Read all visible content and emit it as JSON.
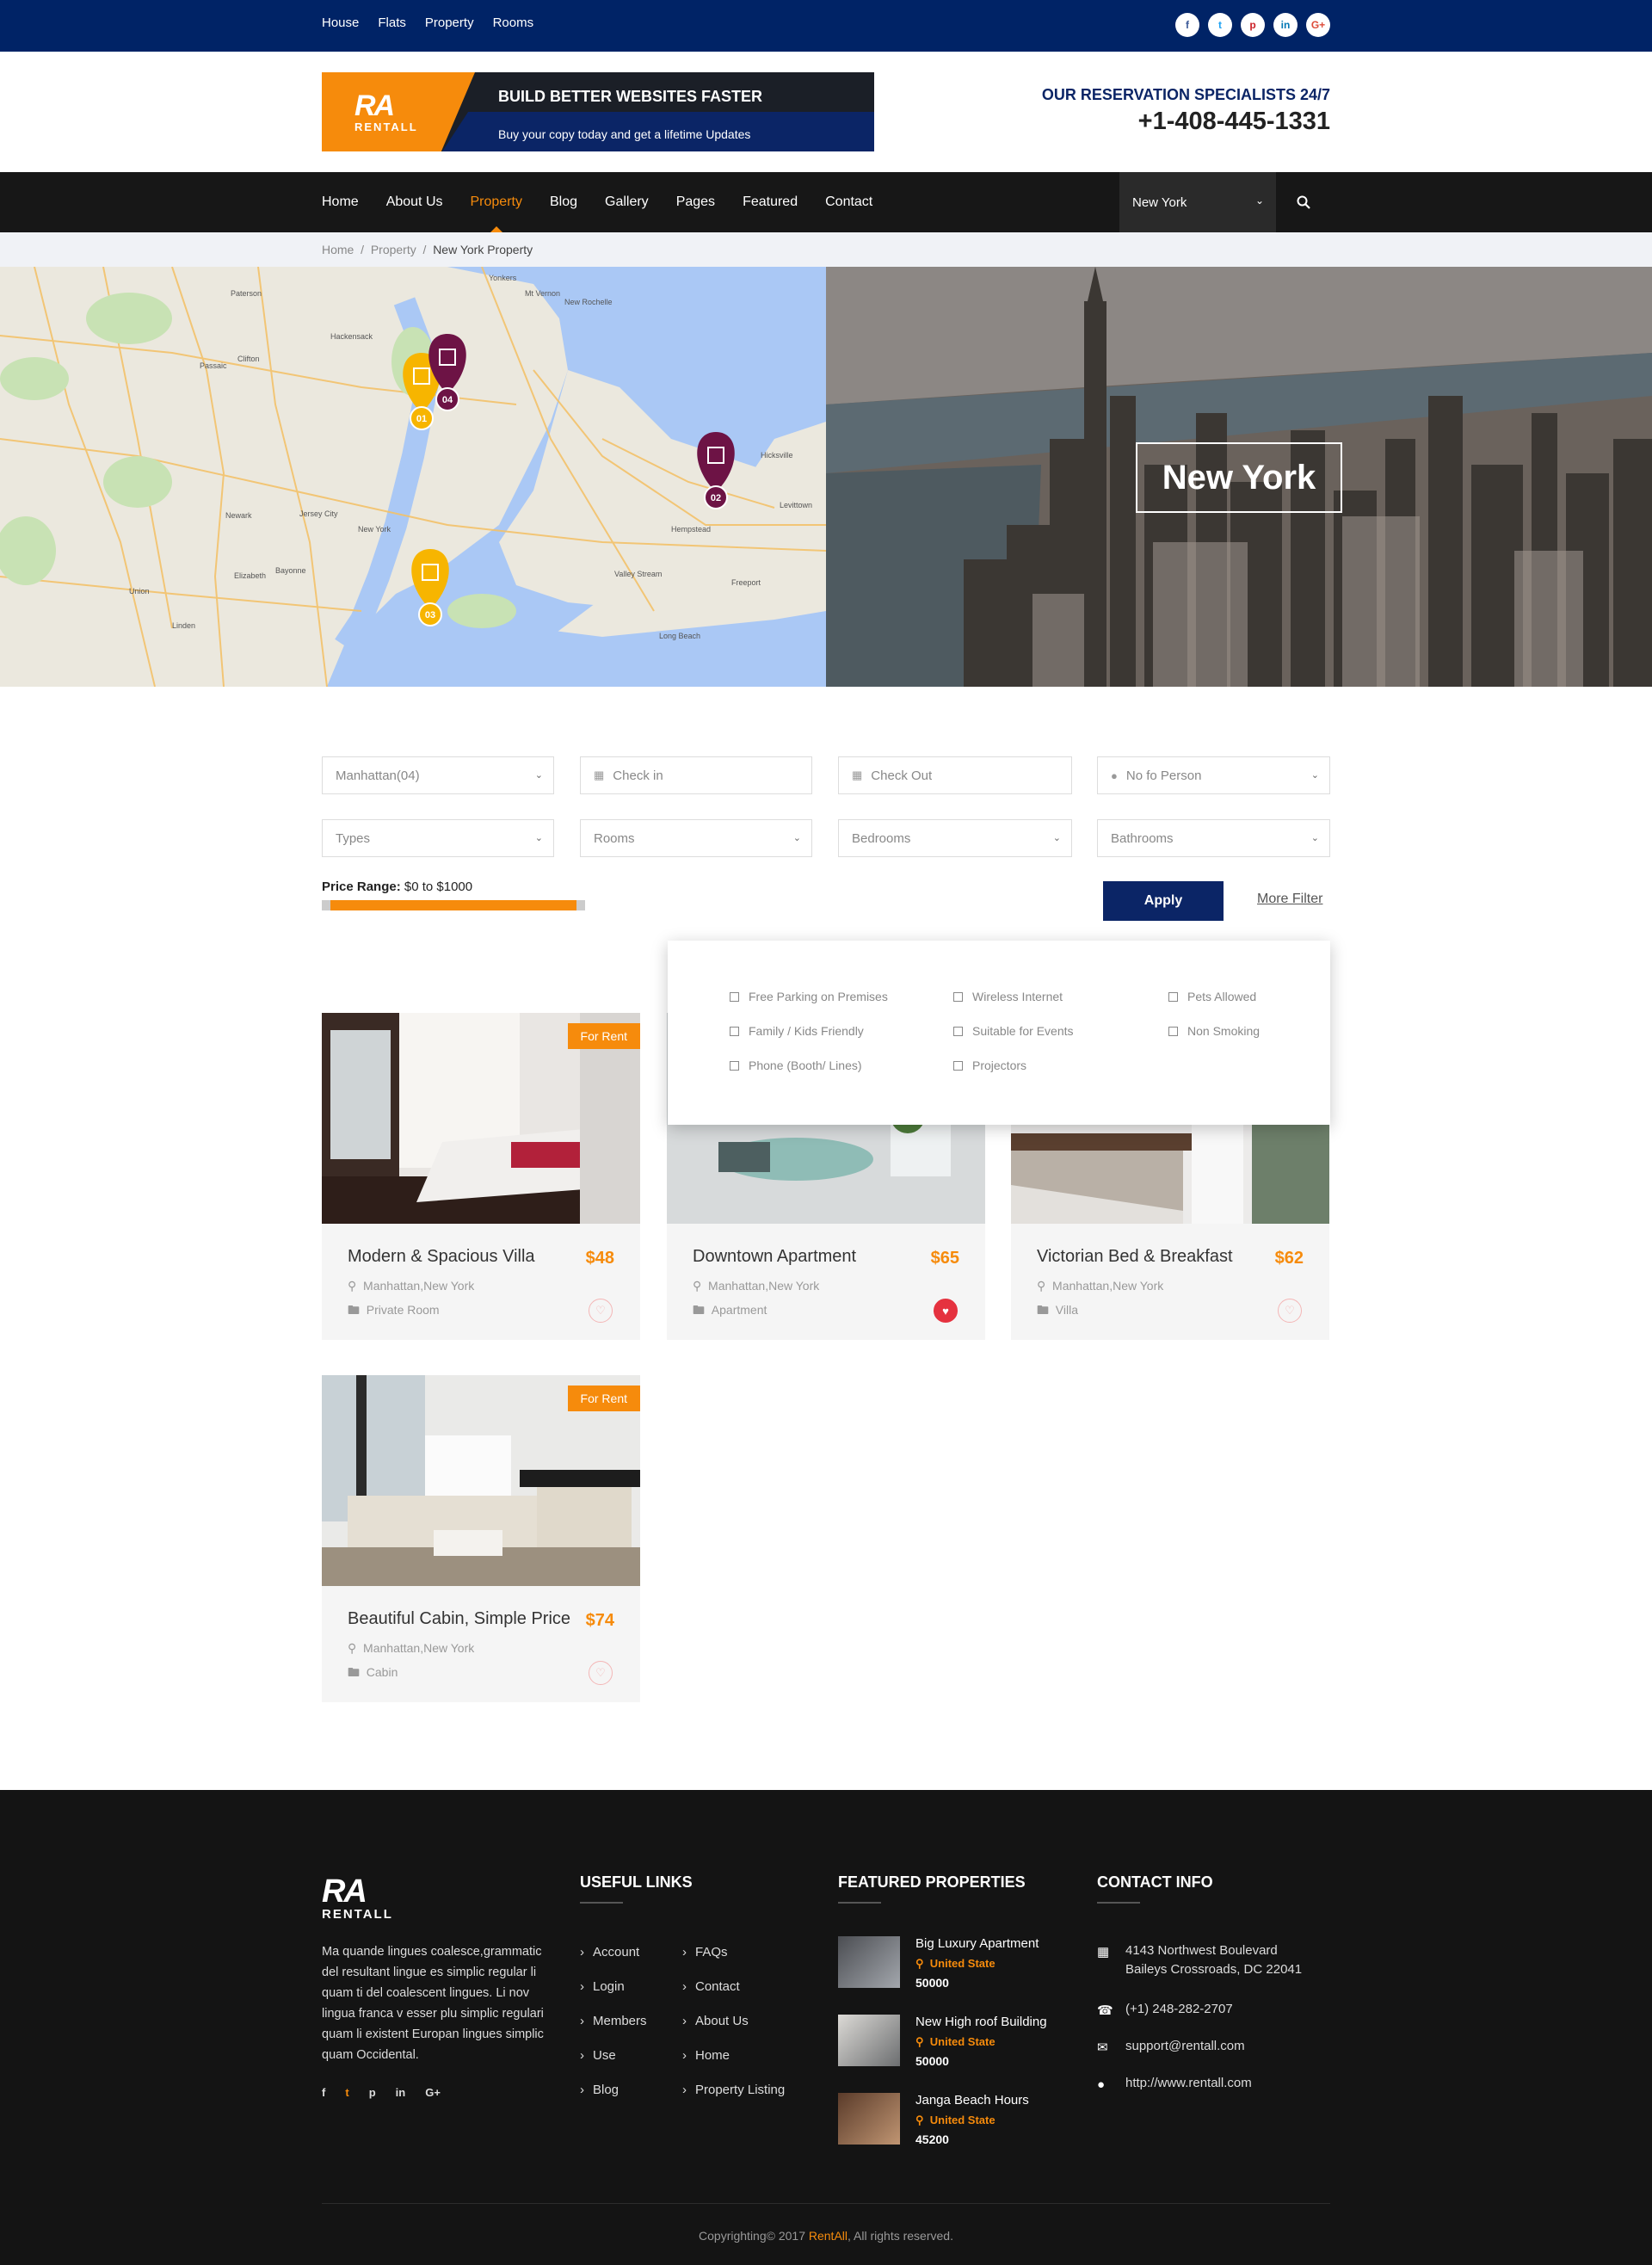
{
  "topbar": {
    "links": [
      "House",
      "Flats",
      "Property",
      "Rooms"
    ],
    "social": [
      {
        "icon": "facebook-icon",
        "glyph": "f",
        "color": "#3b5998"
      },
      {
        "icon": "twitter-icon",
        "glyph": "t",
        "color": "#1da1f2"
      },
      {
        "icon": "pinterest-icon",
        "glyph": "p",
        "color": "#cb2027"
      },
      {
        "icon": "linkedin-icon",
        "glyph": "in",
        "color": "#0077b5"
      },
      {
        "icon": "google-plus-icon",
        "glyph": "G+",
        "color": "#dd4b39"
      }
    ]
  },
  "header": {
    "logo_mark": "RA",
    "logo_text": "RENTALL",
    "banner_title": "BUILD BETTER WEBSITES FASTER",
    "banner_sub": "Buy your copy today and get a lifetime Updates",
    "reserve_label": "OUR RESERVATION SPECIALISTS 24/7",
    "reserve_phone": "+1-408-445-1331"
  },
  "nav": {
    "items": [
      "Home",
      "About Us",
      "Property",
      "Blog",
      "Gallery",
      "Pages",
      "Featured",
      "Contact"
    ],
    "active": "Property",
    "city_select": "New York"
  },
  "breadcrumb": {
    "home": "Home",
    "section": "Property",
    "current": "New York Property"
  },
  "hero": {
    "city_title": "New York",
    "map_pins": [
      {
        "label": "01",
        "color": "#f7b500"
      },
      {
        "label": "04",
        "color": "#6d1345"
      },
      {
        "label": "02",
        "color": "#6d1345"
      },
      {
        "label": "03",
        "color": "#f7b500"
      }
    ],
    "map_labels": [
      "Paterson",
      "Passaic",
      "Hackensack",
      "Jersey City",
      "Newark",
      "New York",
      "Elizabeth",
      "Bayonne",
      "Hempstead",
      "Levittown",
      "Long Beach",
      "Valley Stream",
      "Freeport",
      "Hicksville",
      "New Rochelle",
      "Mt Vernon",
      "Yonkers",
      "Clifton",
      "Linden",
      "Union"
    ]
  },
  "filters": {
    "location": "Manhattan(04)",
    "checkin": "Check in",
    "checkout": "Check Out",
    "persons": "No fo Person",
    "types": "Types",
    "rooms": "Rooms",
    "bedrooms": "Bedrooms",
    "bathrooms": "Bathrooms",
    "price_label": "Price Range:",
    "price_range": "$0 to $1000",
    "price_fill": 1.0,
    "apply": "Apply",
    "more": "More Filter"
  },
  "amenities": [
    "Free Parking on Premises",
    "Wireless Internet",
    "Pets Allowed",
    "Family / Kids Friendly",
    "Suitable for Events",
    "Non Smoking",
    "Phone (Booth/ Lines)",
    "Projectors"
  ],
  "listings": [
    {
      "title": "Modern & Spacious Villa",
      "price": "$48",
      "location": "Manhattan,New York",
      "type": "Private Room",
      "tag": "For Rent",
      "favorite": false
    },
    {
      "title": "Downtown Apartment",
      "price": "$65",
      "location": "Manhattan,New York",
      "type": "Apartment",
      "tag": "",
      "favorite": true
    },
    {
      "title": "Victorian Bed & Breakfast",
      "price": "$62",
      "location": "Manhattan,New York",
      "type": "Villa",
      "tag": "",
      "favorite": false
    },
    {
      "title": "Beautiful Cabin, Simple Price",
      "price": "$74",
      "location": "Manhattan,New York",
      "type": "Cabin",
      "tag": "For Rent",
      "favorite": false
    }
  ],
  "footer": {
    "logo_mark": "RA",
    "logo_text": "RENTALL",
    "about": "Ma quande lingues coalesce,grammatic del resultant lingue es simplic regular li quam ti del coalescent lingues. Li nov lingua franca v esser plu simplic regulari quam li existent Europan lingues simplic quam Occidental.",
    "social": [
      "facebook-icon",
      "twitter-icon",
      "pinterest-icon",
      "linkedin-icon",
      "google-plus-icon"
    ],
    "useful_title": "USEFUL LINKS",
    "links_col1": [
      "Account",
      "Login",
      "Members",
      "Use",
      "Blog"
    ],
    "links_col2": [
      "FAQs",
      "Contact",
      "About Us",
      "Home",
      "Property Listing"
    ],
    "featured_title": "FEATURED PROPERTIES",
    "featured": [
      {
        "name": "Big Luxury Apartment",
        "country": "United State",
        "price": "50000"
      },
      {
        "name": "New High roof Building",
        "country": "United State",
        "price": "50000"
      },
      {
        "name": "Janga Beach Hours",
        "country": "United State",
        "price": "45200"
      }
    ],
    "contact_title": "CONTACT INFO",
    "address1": "4143 Northwest Boulevard",
    "address2": "Baileys Crossroads, DC 22041",
    "phone": "(+1) 248-282-2707",
    "email": "support@rentall.com",
    "web": "http://www.rentall.com",
    "copyright_pre": "Copyrighting© 2017 ",
    "copyright_brand": "RentAll",
    "copyright_post": ", All rights reserved."
  }
}
